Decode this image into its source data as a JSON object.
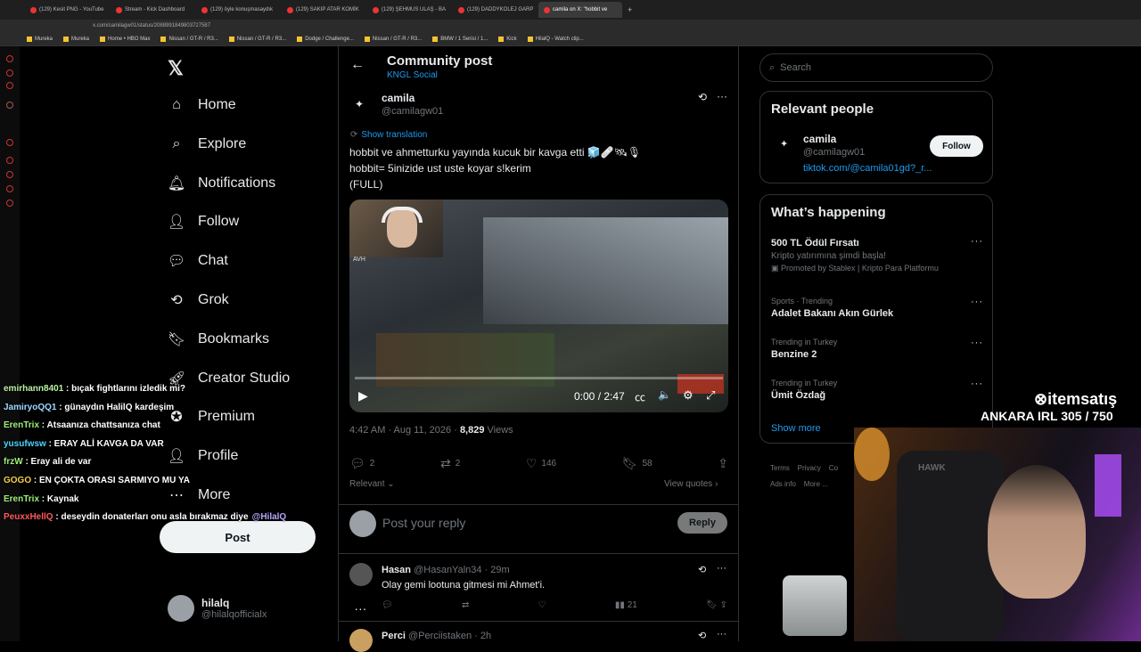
{
  "browser": {
    "tabs": [
      {
        "label": "(129) Kesit PNG - YouTube",
        "active": false
      },
      {
        "label": "Stream - Kick Dashboard",
        "active": false
      },
      {
        "label": "(129) öyle konuşmasaydık",
        "active": false
      },
      {
        "label": "(129) SAKIP ATAR KOMİK",
        "active": false
      },
      {
        "label": "(129) ŞEHMUS ULAŞ - BA",
        "active": false
      },
      {
        "label": "(129) DADDYKOLEJ GARP",
        "active": false
      },
      {
        "label": "camila on X: \"hobbit ve",
        "active": true
      }
    ],
    "url": "x.com/camilagw01/status/2088991849803727587",
    "bookmarks": [
      "Mureka",
      "Mureka",
      "Home • HBO Max",
      "Nissan / GT-R / R3...",
      "Nissan / GT-R / R3...",
      "Dodge / Challenge...",
      "Nissan / GT-R / R3...",
      "BMW / 1 Serisi / 1...",
      "Kick",
      "HilalQ - Watch clip..."
    ]
  },
  "nav": {
    "items": [
      {
        "label": "Home",
        "icon": "home-icon"
      },
      {
        "label": "Explore",
        "icon": "search-icon"
      },
      {
        "label": "Notifications",
        "icon": "bell-icon"
      },
      {
        "label": "Follow",
        "icon": "follow-icon"
      },
      {
        "label": "Chat",
        "icon": "chat-icon"
      },
      {
        "label": "Grok",
        "icon": "grok-icon"
      },
      {
        "label": "Bookmarks",
        "icon": "bookmark-icon"
      },
      {
        "label": "Creator Studio",
        "icon": "creator-icon"
      },
      {
        "label": "Premium",
        "icon": "premium-icon"
      },
      {
        "label": "Profile",
        "icon": "profile-icon"
      },
      {
        "label": "More",
        "icon": "more-icon"
      }
    ],
    "post_label": "Post",
    "account": {
      "name": "hilalq",
      "handle": "@hilalqofficialx"
    }
  },
  "header": {
    "title": "Community post",
    "subtitle": "KNGL Social"
  },
  "post": {
    "author": "camila",
    "handle": "@camilagw01",
    "show_translation": "Show translation",
    "text_line1": "hobbit ve ahmetturku yayında kucuk bir kavga etti",
    "text_line2": "hobbit= 5inizide ust uste koyar s!kerim",
    "text_line3": "(FULL)",
    "video_time": "0:00 / 2:47",
    "video_progress": 0,
    "game_label": "AVH",
    "time": "4:42 AM · Aug 11, 2026 · ",
    "views_count": "8,829",
    "views_label": " Views",
    "stats": {
      "replies": "2",
      "reposts": "2",
      "likes": "146",
      "bookmarks": "58"
    },
    "relevant_label": "Relevant",
    "view_quotes": "View quotes"
  },
  "reply_box": {
    "placeholder": "Post your reply",
    "button": "Reply"
  },
  "replies": [
    {
      "name": "Hasan",
      "handle": "@HasanYaln34",
      "time": "· 29m",
      "text": "Olay gemi lootuna gitmesi mi Ahmet'i.",
      "views": "21"
    },
    {
      "name": "Perci",
      "handle": "@Perciistaken",
      "time": "· 2h"
    }
  ],
  "search": {
    "placeholder": "Search"
  },
  "relevant_people": {
    "title": "Relevant people",
    "name": "camila",
    "handle": "@camilagw01",
    "link": "tiktok.com/@camila01gd?_r...",
    "follow": "Follow"
  },
  "whats_happening": {
    "title": "What’s happening",
    "items": [
      {
        "title": "500 TL Ödül Fırsatı",
        "sub": "Kripto yatırımına şimdi başla!",
        "promo": "Promoted by Stablex | Kripto Para Platformu"
      },
      {
        "context": "Sports · Trending",
        "title": "Adalet Bakanı Akın Gürlek"
      },
      {
        "context": "Trending in Turkey",
        "title": "Benzine 2"
      },
      {
        "context": "Trending in Turkey",
        "title": "Ümit Özdağ"
      }
    ],
    "show_more": "Show more"
  },
  "footer_links": [
    "Terms",
    "Privacy",
    "Co",
    "Ads info",
    "More ..."
  ],
  "chat": [
    {
      "user": "emirhann8401",
      "color": "#b7f0a0",
      "msg": " : bıçak fightlarını izledik mi?"
    },
    {
      "user": "JamiryoQQ1",
      "color": "#9fd8ff",
      "msg": " : günaydın HalilQ kardeşim"
    },
    {
      "user": "ErenTrix",
      "color": "#9ef07a",
      "msg": " : Atsaanıza chattsanıza chat"
    },
    {
      "user": "yusufwsw",
      "color": "#4ad4ff",
      "msg": " : ERAY ALİ KAVGA DA VAR"
    },
    {
      "user": "frzW",
      "color": "#9ef07a",
      "msg": " : Eray ali de var"
    },
    {
      "user": "GOGO",
      "color": "#f0d04a",
      "msg": " : EN ÇOKTA ORASI SARMIYO MU YA"
    },
    {
      "user": "ErenTrix",
      "color": "#9ef07a",
      "msg": " : Kaynak"
    },
    {
      "user": "PeuxxHellQ",
      "color": "#ff5a5a",
      "msg": " : deseydin donaterları onu asla bırakmaz diye",
      "mention": "@HilalQ"
    }
  ],
  "overlay": {
    "brand": "itemsatış",
    "counter": "ANKARA IRL 305 / 750"
  },
  "colors": {
    "accent": "#1d9bf0",
    "bg": "#000000",
    "border": "#2f3336",
    "muted": "#71767b"
  }
}
